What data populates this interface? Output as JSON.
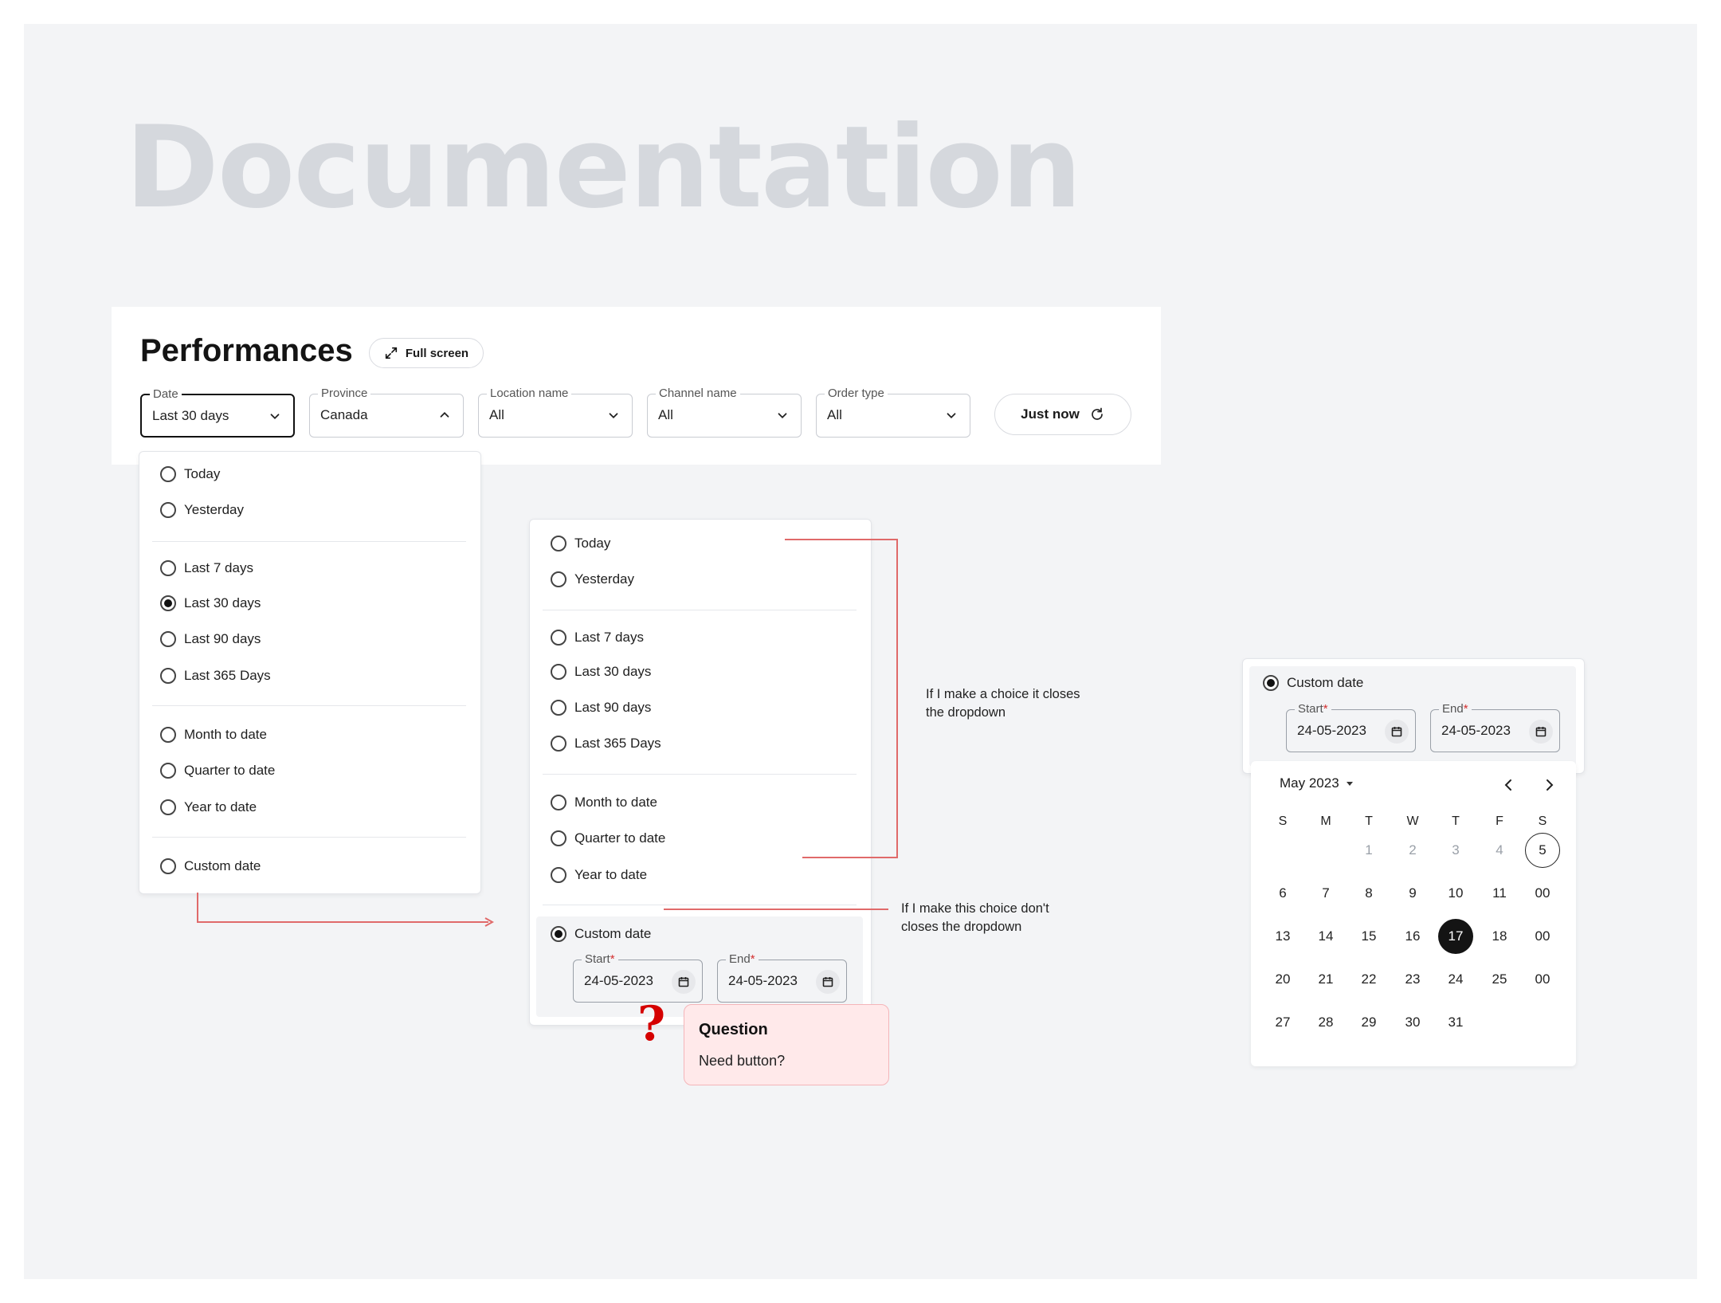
{
  "doc_title": "Documentation",
  "header": {
    "title": "Performances",
    "fullscreen_label": "Full screen",
    "refresh_label": "Just now"
  },
  "filters": {
    "date": {
      "label": "Date",
      "value": "Last 30 days"
    },
    "province": {
      "label": "Province",
      "value": "Canada"
    },
    "location": {
      "label": "Location name",
      "value": "All"
    },
    "channel": {
      "label": "Channel name",
      "value": "All"
    },
    "order_type": {
      "label": "Order type",
      "value": "All"
    }
  },
  "date_options": {
    "today": "Today",
    "yesterday": "Yesterday",
    "last7": "Last 7 days",
    "last30": "Last 30 days",
    "last90": "Last 90 days",
    "last365": "Last 365 Days",
    "mtd": "Month to date",
    "qtd": "Quarter to date",
    "ytd": "Year to date",
    "custom": "Custom date"
  },
  "custom_range": {
    "start_label": "Start",
    "end_label": "End",
    "required_mark": "*",
    "start_value": "24-05-2023",
    "end_value": "24-05-2023"
  },
  "notes": {
    "closes_line1": "If I make a choice it closes",
    "closes_line2": "the dropdown",
    "not_closes_line1": "If I make this choice don't",
    "not_closes_line2": "closes the dropdown"
  },
  "question": {
    "mark": "?",
    "title": "Question",
    "body": "Need button?"
  },
  "calendar": {
    "month_label": "May 2023",
    "weekdays": [
      "S",
      "M",
      "T",
      "W",
      "T",
      "F",
      "S"
    ],
    "weeks": [
      [
        "",
        "",
        "1",
        "2",
        "3",
        "4",
        "5"
      ],
      [
        "6",
        "7",
        "8",
        "9",
        "10",
        "11",
        "00"
      ],
      [
        "13",
        "14",
        "15",
        "16",
        "17",
        "18",
        "00"
      ],
      [
        "20",
        "21",
        "22",
        "23",
        "24",
        "25",
        "00"
      ],
      [
        "27",
        "28",
        "29",
        "30",
        "31",
        "",
        ""
      ]
    ],
    "muted_days": [
      "1",
      "2",
      "3",
      "4"
    ],
    "today": "5",
    "selected": "17"
  },
  "colors": {
    "accent": "#141414",
    "annotation_line": "#e06a6a",
    "required": "#d32f2f",
    "question_bg": "#ffe9ea",
    "question_mark": "#d50000"
  }
}
